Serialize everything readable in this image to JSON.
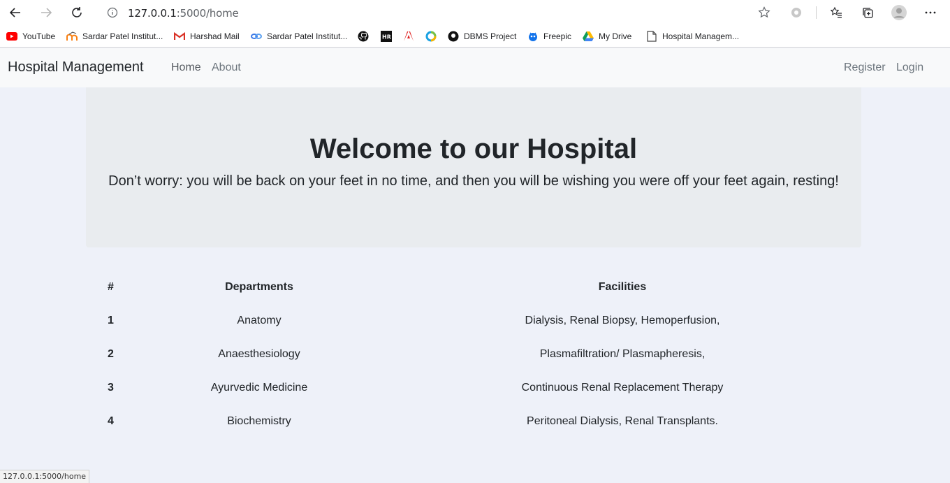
{
  "browser": {
    "url_host": "127.0.0.1",
    "url_rest": ":5000/home",
    "status_url": "127.0.0.1:5000/home",
    "icons": [
      "back-arrow-icon",
      "forward-arrow-icon",
      "reload-icon",
      "info-icon",
      "star-icon",
      "extension-icon",
      "favorites-icon",
      "collections-icon",
      "profile-avatar",
      "more-icon"
    ]
  },
  "bookmarks": [
    {
      "label": "YouTube",
      "icon": "youtube-icon",
      "color": "#ff0000"
    },
    {
      "label": "Sardar Patel Institut...",
      "icon": "moodle-icon",
      "color": "#f98012"
    },
    {
      "label": "Harshad Mail",
      "icon": "gmail-icon",
      "color": "#d93025"
    },
    {
      "label": "Sardar Patel Institut...",
      "icon": "link-icon",
      "color": "#3b78e7"
    },
    {
      "label": "",
      "icon": "github-icon",
      "color": "#000000"
    },
    {
      "label": "",
      "icon": "hackerrank-icon",
      "color": "#000000"
    },
    {
      "label": "",
      "icon": "adobe-icon",
      "color": "#e01f1f"
    },
    {
      "label": "",
      "icon": "circle-app-icon",
      "color": "#1ba1e2"
    },
    {
      "label": "DBMS Project",
      "icon": "github-icon",
      "color": "#000000"
    },
    {
      "label": "Freepic",
      "icon": "freepik-icon",
      "color": "#1273eb"
    },
    {
      "label": "My Drive",
      "icon": "drive-icon",
      "color": "#0f9d58"
    },
    {
      "label": "Hospital Managem...",
      "icon": "page-icon",
      "color": "#444444"
    }
  ],
  "navbar": {
    "brand": "Hospital Management",
    "links": [
      "Home",
      "About"
    ],
    "right_links": [
      "Register",
      "Login"
    ]
  },
  "jumbotron": {
    "title": "Welcome to our Hospital",
    "text": "Don’t worry: you will be back on your feet in no time, and then you will be wishing you were off your feet again, resting!"
  },
  "table": {
    "headers": [
      "#",
      "Departments",
      "Facilities"
    ],
    "rows": [
      [
        "1",
        "Anatomy",
        "Dialysis, Renal Biopsy, Hemoperfusion,"
      ],
      [
        "2",
        "Anaesthesiology",
        "Plasmafiltration/ Plasmapheresis,"
      ],
      [
        "3",
        "Ayurvedic Medicine",
        "Continuous Renal Replacement Therapy"
      ],
      [
        "4",
        "Biochemistry",
        "Peritoneal Dialysis, Renal Transplants."
      ]
    ]
  }
}
